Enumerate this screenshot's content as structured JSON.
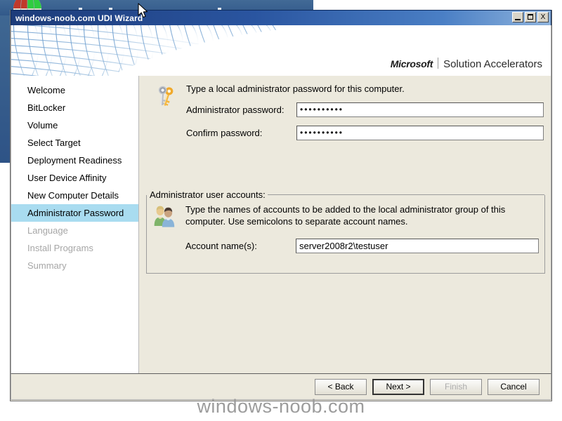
{
  "desktop": {
    "logo_name": "windows-logo-partial",
    "logo_colors": [
      "#c0392b",
      "#2ecc40",
      "#f2f0e6",
      "#1f4e89"
    ]
  },
  "window": {
    "title": "windows-noob.com UDI Wizard",
    "controls": {
      "minimize_label": "",
      "maximize_label": "",
      "close_label": "X"
    }
  },
  "header": {
    "brand_microsoft": "Microsoft",
    "brand_product": "Solution Accelerators",
    "mesh_icon": "mesh-pattern-graphic"
  },
  "sidebar": {
    "items": [
      {
        "label": "Welcome",
        "state": "normal"
      },
      {
        "label": "BitLocker",
        "state": "normal"
      },
      {
        "label": "Volume",
        "state": "normal"
      },
      {
        "label": "Select Target",
        "state": "normal"
      },
      {
        "label": "Deployment Readiness",
        "state": "normal"
      },
      {
        "label": "User Device Affinity",
        "state": "normal"
      },
      {
        "label": "New Computer Details",
        "state": "normal"
      },
      {
        "label": "Administrator Password",
        "state": "selected"
      },
      {
        "label": "Language",
        "state": "disabled"
      },
      {
        "label": "Install Programs",
        "state": "disabled"
      },
      {
        "label": "Summary",
        "state": "disabled"
      }
    ],
    "selected_color": "#a9dcf0",
    "disabled_color": "#a6a6a6"
  },
  "main": {
    "password_section": {
      "icon": "keys-icon",
      "intro": "Type a local administrator password for this computer.",
      "admin_password_label": "Administrator password:",
      "admin_password_value": "••••••••••",
      "confirm_password_label": "Confirm password:",
      "confirm_password_value": "••••••••••"
    },
    "accounts_section": {
      "legend": "Administrator user accounts:",
      "icon": "users-icon",
      "description": "Type the names of accounts to be added to the local administrator group of this computer. Use semicolons to separate account names.",
      "account_names_label": "Account name(s):",
      "account_names_value": "server2008r2\\testuser"
    }
  },
  "footer": {
    "back_label": "< Back",
    "next_label": "Next >",
    "finish_label": "Finish",
    "cancel_label": "Cancel"
  },
  "watermark": {
    "text": "windows-noob.com"
  }
}
